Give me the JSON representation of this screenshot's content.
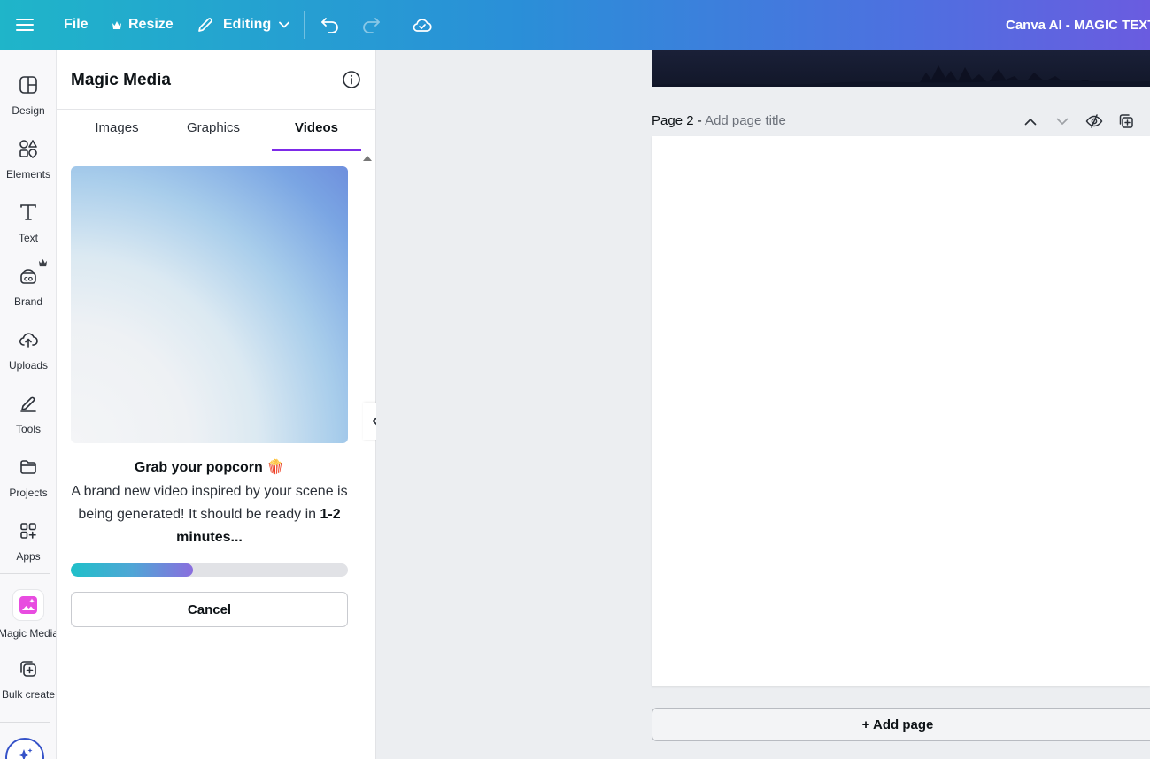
{
  "topbar": {
    "menu_icon": "hamburger-icon",
    "file_label": "File",
    "resize_label": "Resize",
    "editing_label": "Editing",
    "doc_title": "Canva AI - MAGIC TEXT T"
  },
  "rail": {
    "items": [
      {
        "label": "Design",
        "icon": "design-icon"
      },
      {
        "label": "Elements",
        "icon": "elements-icon"
      },
      {
        "label": "Text",
        "icon": "text-icon"
      },
      {
        "label": "Brand",
        "icon": "brand-icon"
      },
      {
        "label": "Uploads",
        "icon": "uploads-icon"
      },
      {
        "label": "Tools",
        "icon": "tools-icon"
      },
      {
        "label": "Projects",
        "icon": "projects-icon"
      },
      {
        "label": "Apps",
        "icon": "apps-icon"
      },
      {
        "label": "Magic Media",
        "icon": "magic-media-icon"
      },
      {
        "label": "Bulk create",
        "icon": "bulk-create-icon"
      }
    ]
  },
  "panel": {
    "title": "Magic Media",
    "tabs": [
      {
        "label": "Images"
      },
      {
        "label": "Graphics"
      },
      {
        "label": "Videos",
        "active": true
      }
    ],
    "generation": {
      "title": "Grab your popcorn",
      "emoji": "🍿",
      "text_before": "A brand new video inspired by your scene is being generated! It should be ready in ",
      "text_bold": "1-2 minutes...",
      "progress": 0.44
    },
    "cancel_label": "Cancel"
  },
  "canvas": {
    "page_number": "Page 2 -",
    "page_title_placeholder": "Add page title",
    "add_page_label": "+ Add page"
  },
  "colors": {
    "accent_purple": "#7d2ae8",
    "magic_media_pink": "#e84ce0",
    "topbar_start": "#1fb5c9",
    "topbar_end": "#6a5ce0"
  }
}
